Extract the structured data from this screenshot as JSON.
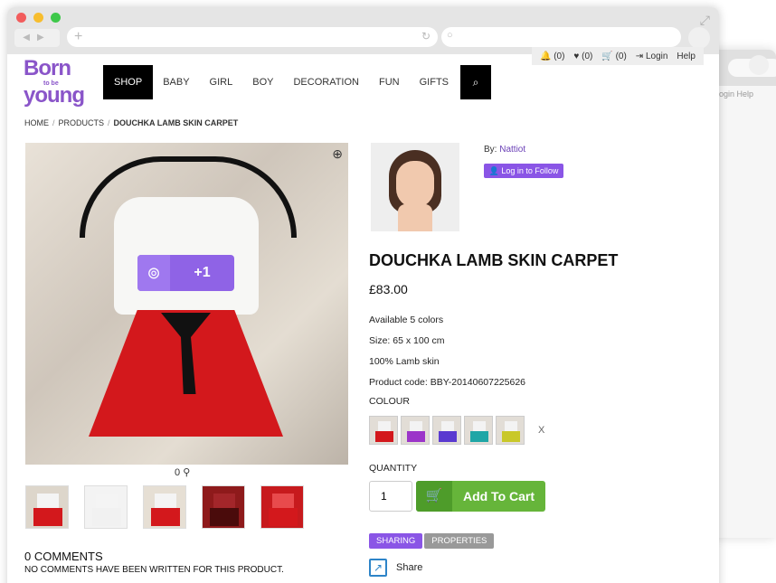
{
  "util": {
    "notifications": "(0)",
    "favorites": "(0)",
    "cart": "(0)",
    "login": "Login",
    "help": "Help"
  },
  "logo": {
    "line1": "Born",
    "line2": "to be",
    "line3": "young"
  },
  "nav": {
    "items": [
      "SHOP",
      "BABY",
      "GIRL",
      "BOY",
      "DECORATION",
      "FUN",
      "GIFTS"
    ],
    "active": "SHOP"
  },
  "breadcrumb": {
    "home": "HOME",
    "products": "PRODUCTS",
    "current": "DOUCHKA LAMB SKIN CARPET"
  },
  "image": {
    "plusone": "+1",
    "likes": "0"
  },
  "seller": {
    "by_label": "By:",
    "name": "Nattiot",
    "follow": "Log in to Follow"
  },
  "product": {
    "title": "DOUCHKA LAMB SKIN CARPET",
    "price": "£83.00",
    "specs": [
      "Available 5 colors",
      "Size: 65 x 100 cm",
      "100% Lamb skin",
      "Product code: BBY-20140607225626"
    ],
    "colour_label": "COLOUR",
    "colours": [
      "#d3181c",
      "#9b35c9",
      "#5a3ad0",
      "#1fa6a6",
      "#c9c829"
    ],
    "clear": "X",
    "quantity_label": "QUANTITY",
    "quantity": "1",
    "add_to_cart": "Add To Cart"
  },
  "tabs": [
    "SHARING",
    "PROPERTIES"
  ],
  "share": "Share",
  "comments": {
    "title": "0 COMMENTS",
    "text": "NO COMMENTS HAVE BEEN WRITTEN FOR THIS PRODUCT."
  },
  "ghost": {
    "links": "ogin  Help"
  }
}
